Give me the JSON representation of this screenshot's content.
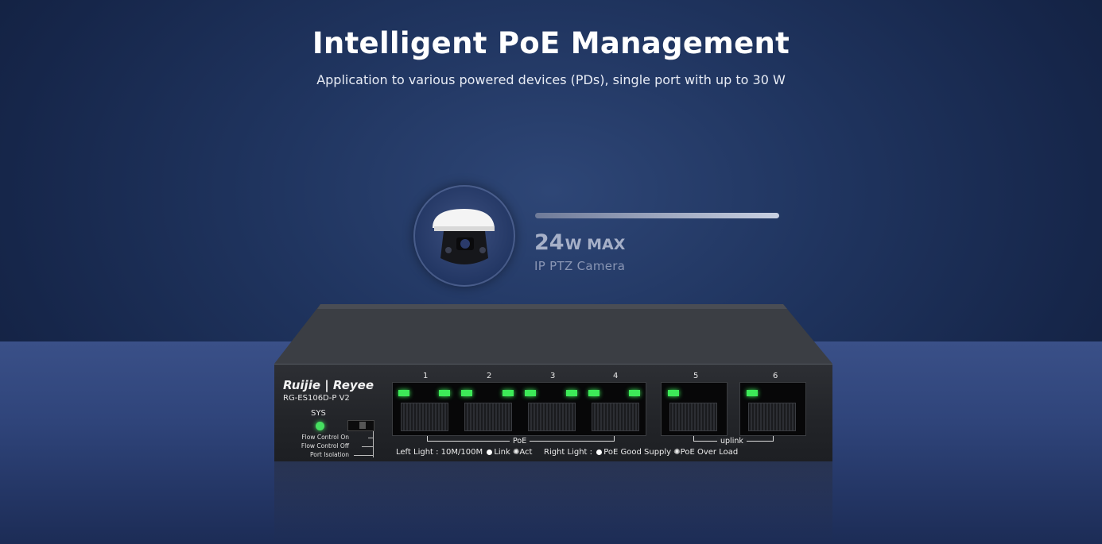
{
  "header": {
    "title": "Intelligent PoE Management",
    "subtitle": "Application to various powered devices (PDs), single port with up to 30 W"
  },
  "device_callout": {
    "power_value": "24",
    "power_unit": "W MAX",
    "device": "IP  PTZ Camera",
    "power_fraction": 0.8
  },
  "switch": {
    "brand": "Ruijie | Reyee",
    "model": "RG-ES106D-P V2",
    "sys_label": "SYS",
    "dip_options": [
      "Flow Control On",
      "Flow Control Off",
      "Port Isolation"
    ],
    "ports": [
      {
        "number": "1"
      },
      {
        "number": "2"
      },
      {
        "number": "3"
      },
      {
        "number": "4"
      },
      {
        "number": "5"
      },
      {
        "number": "6"
      }
    ],
    "poe_group_label": "PoE",
    "uplink_group_label": "uplink",
    "legend_left_prefix": "Left Light : 10M/100M",
    "legend_link": "Link",
    "legend_act": "Act",
    "legend_right_prefix": "Right Light :",
    "legend_good": "PoE Good Supply",
    "legend_overload": "PoE Over Load"
  },
  "colors": {
    "led_green": "#3dea58",
    "background_navy": "#1b2d58"
  }
}
